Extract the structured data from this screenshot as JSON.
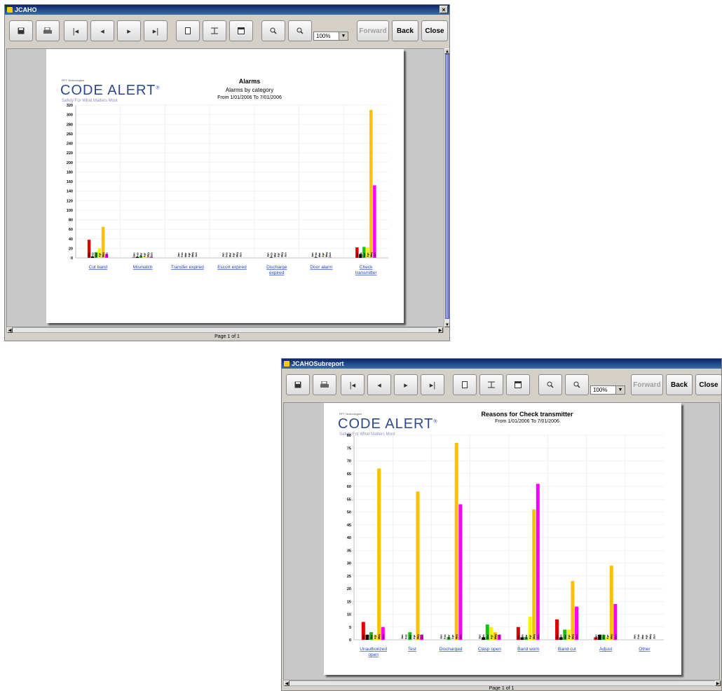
{
  "window1": {
    "title": "JCAHO",
    "close_glyph": "×",
    "toolbar": {
      "icons": [
        "save-icon",
        "print-icon",
        "first-page-icon",
        "previous-page-icon",
        "next-page-icon",
        "last-page-icon",
        "single-page-icon",
        "fit-width-icon",
        "fit-page-icon",
        "zoom-in-icon",
        "zoom-out-icon"
      ],
      "zoom_value": "100%",
      "forward_label": "Forward",
      "back_label": "Back",
      "close_label": "Close"
    },
    "status": "Page 1 of 1",
    "report": {
      "logo_small": "RFT Technologies",
      "logo": "CODE ALERT",
      "logo_mark": "®",
      "tagline": "Safety For What Matters Most",
      "title": "Alarms",
      "subtitle": "Alarms by category",
      "date_range": "From 1/01/2006 To 7/01/2006"
    }
  },
  "window2": {
    "title": "JCAHOSubreport",
    "toolbar": {
      "zoom_value": "100%",
      "forward_label": "Forward",
      "back_label": "Back",
      "close_label": "Close"
    },
    "status": "Page 1 of 1",
    "report": {
      "logo_small": "RFT Technologies",
      "logo": "CODE ALERT",
      "logo_mark": "®",
      "tagline": "Safety For What Matters Most",
      "title": "Reasons for Check transmitter",
      "date_range": "From 1/01/2006 To 7/01/2006"
    }
  },
  "colors": {
    "series": [
      "#e00000",
      "#101010",
      "#18c018",
      "#f8f400",
      "#ffc000",
      "#ff00ff"
    ],
    "link": "#1a3fd1"
  },
  "chart_data": [
    {
      "type": "bar",
      "title": "Alarms",
      "subtitle": "Alarms by category",
      "series_labels": [
        "Jan",
        "Feb",
        "Mar",
        "Apr",
        "May",
        "Jun"
      ],
      "categories": [
        "Cut band",
        "Mismatch",
        "Transfer expired",
        "Escort expired",
        "Discharge expired",
        "Door alarm",
        "Check transmitter"
      ],
      "values": [
        [
          38,
          3,
          12,
          20,
          65,
          8
        ],
        [
          1,
          2,
          4,
          3,
          2,
          2
        ],
        [
          0,
          0,
          0,
          0,
          0,
          0
        ],
        [
          0,
          0,
          0,
          0,
          0,
          0
        ],
        [
          0,
          1,
          0,
          0,
          0,
          0
        ],
        [
          0,
          1,
          0,
          1,
          0,
          1
        ],
        [
          22,
          8,
          23,
          22,
          310,
          152
        ]
      ],
      "ylim": [
        0,
        320
      ],
      "yticks": [
        0,
        20,
        40,
        60,
        80,
        100,
        120,
        140,
        160,
        180,
        200,
        220,
        240,
        260,
        280,
        300,
        320
      ],
      "grid": true
    },
    {
      "type": "bar",
      "title": "Reasons for Check transmitter",
      "series_labels": [
        "Jan",
        "Feb",
        "Mar",
        "Apr",
        "May",
        "Jun"
      ],
      "categories": [
        "Unauthorized open",
        "Test",
        "Discharged",
        "Clasp open",
        "Band worn",
        "Band cut",
        "Adjust",
        "Other"
      ],
      "values": [
        [
          7,
          2,
          3,
          2,
          67,
          5
        ],
        [
          0,
          0,
          3,
          0,
          58,
          2
        ],
        [
          0,
          0,
          1,
          0,
          77,
          53
        ],
        [
          0,
          1,
          6,
          5,
          3,
          2
        ],
        [
          5,
          1,
          1,
          9,
          51,
          61
        ],
        [
          8,
          1,
          4,
          4,
          23,
          13
        ],
        [
          1,
          2,
          2,
          1,
          29,
          14
        ],
        [
          0,
          0,
          0,
          0,
          0,
          0
        ]
      ],
      "ylim": [
        0,
        80
      ],
      "yticks": [
        0,
        5,
        10,
        15,
        20,
        25,
        30,
        35,
        40,
        45,
        50,
        55,
        60,
        65,
        70,
        75,
        80
      ],
      "grid": true
    }
  ]
}
